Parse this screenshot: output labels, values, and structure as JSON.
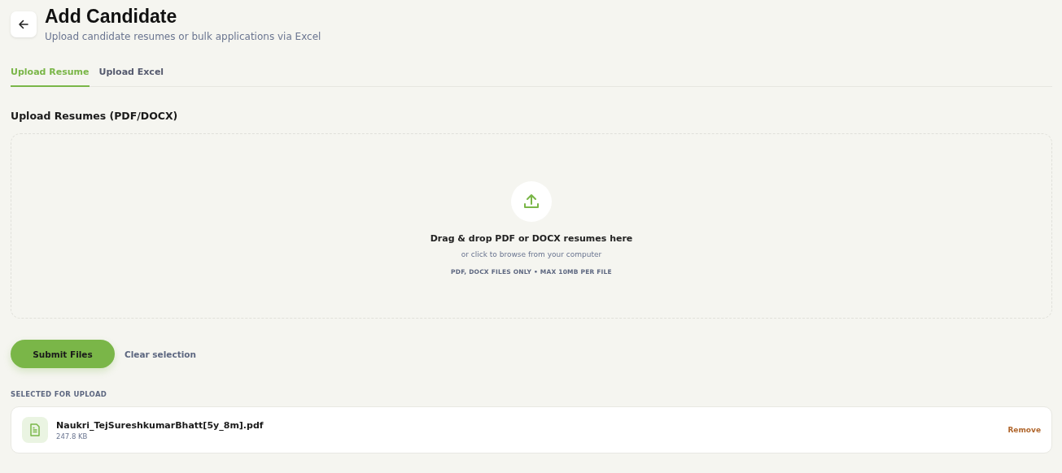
{
  "header": {
    "title": "Add Candidate",
    "subtitle": "Upload candidate resumes or bulk applications via Excel"
  },
  "tabs": [
    {
      "label": "Upload Resume",
      "selected": true
    },
    {
      "label": "Upload Excel",
      "selected": false
    }
  ],
  "section_label": "Upload Resumes (PDF/DOCX)",
  "dropzone": {
    "title": "Drag & drop PDF or DOCX resumes here",
    "hint": "or click to browse from your computer",
    "limits": "PDF, DOCX FILES ONLY • MAX 10MB PER FILE"
  },
  "actions": {
    "submit": "Submit Files",
    "clear": "Clear selection"
  },
  "selected_label": "SELECTED FOR UPLOAD",
  "files": [
    {
      "name": "Naukri_TejSureshkumarBhatt[5y_8m].pdf",
      "size": "247.8 KB",
      "action": "Remove"
    }
  ]
}
